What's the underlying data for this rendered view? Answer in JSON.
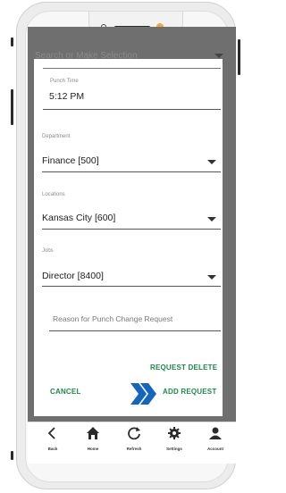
{
  "background_field": {
    "placeholder": "Search or Make Selection"
  },
  "form": {
    "punch_time": {
      "label": "Punch Time",
      "value": "5:12 PM"
    },
    "department": {
      "label": "Department",
      "value": "Finance [500]"
    },
    "locations": {
      "label": "Locations",
      "value": "Kansas City [600]"
    },
    "jobs": {
      "label": "Jobs",
      "value": "Director [8400]"
    },
    "reason": {
      "placeholder": "Reason for Punch Change Request"
    }
  },
  "actions": {
    "request_delete": "REQUEST DELETE",
    "cancel": "CANCEL",
    "add_request": "ADD REQUEST"
  },
  "nav": [
    {
      "label": "Back",
      "icon": "back-icon"
    },
    {
      "label": "Home",
      "icon": "home-icon"
    },
    {
      "label": "Refresh",
      "icon": "refresh-icon"
    },
    {
      "label": "Settings",
      "icon": "settings-icon"
    },
    {
      "label": "Account",
      "icon": "account-icon"
    }
  ],
  "colors": {
    "accent": "#1b8a4a",
    "chevron": "#1565c0",
    "overlay": "#6f6f6f"
  }
}
